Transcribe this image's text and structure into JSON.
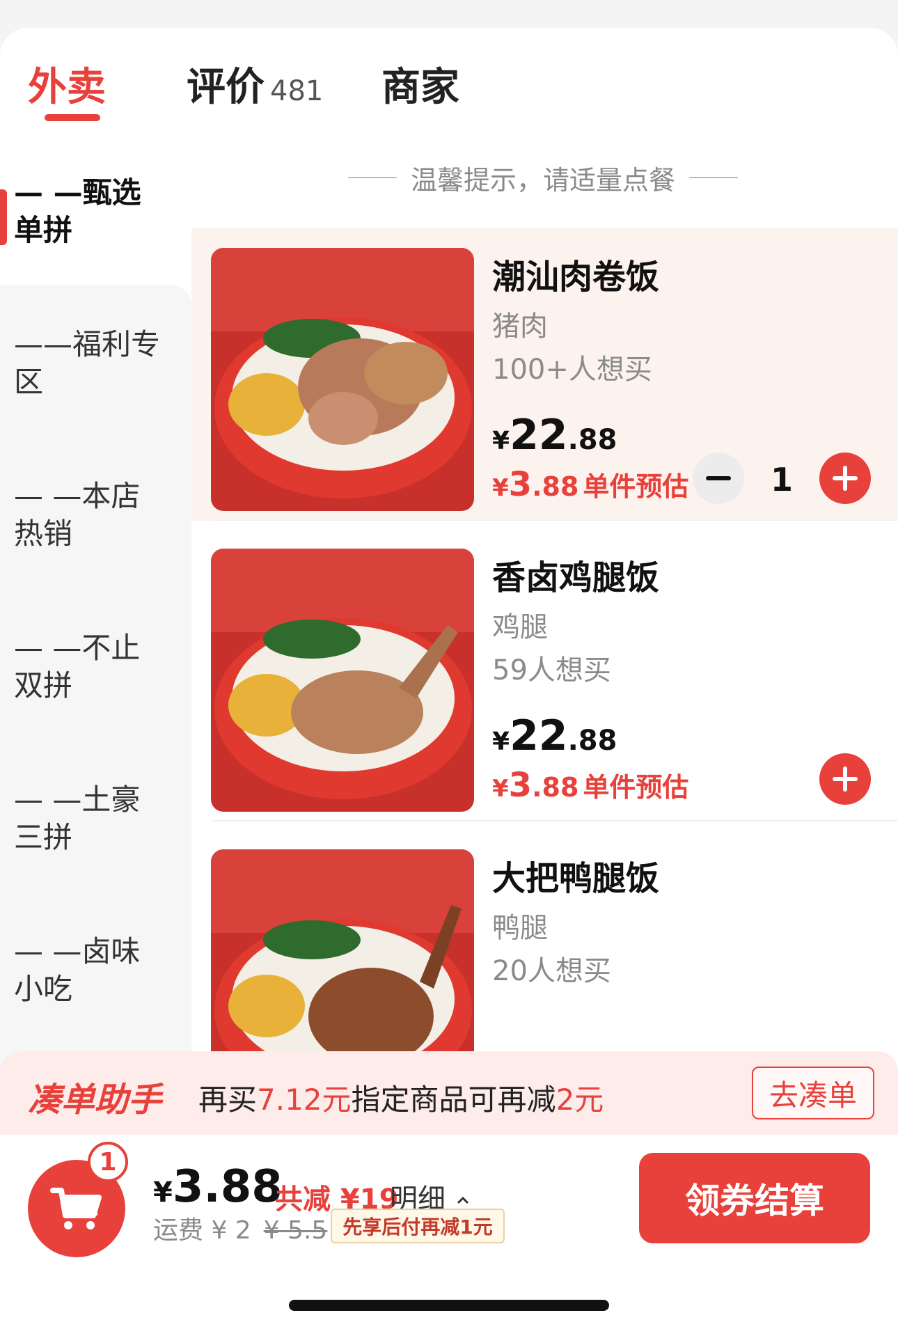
{
  "tabs": {
    "takeout": "外卖",
    "reviews": "评价",
    "reviews_count": "481",
    "merchant": "商家"
  },
  "tip": "温馨提示，请适量点餐",
  "sidebar": {
    "items": [
      {
        "line1": "—  —甄选",
        "line2": "单拼"
      },
      {
        "line1": "——福利专",
        "line2": "区"
      },
      {
        "line1": "—  —本店",
        "line2": "热销"
      },
      {
        "line1": "—  —不止",
        "line2": "双拼"
      },
      {
        "line1": "—  —土豪",
        "line2": "三拼"
      },
      {
        "line1": "—  —卤味",
        "line2": "小吃"
      }
    ]
  },
  "products": [
    {
      "name": "潮汕肉卷饭",
      "desc": "猪肉",
      "want": "100+人想买",
      "price_cur": "¥",
      "price_int": "22",
      "price_dec": ".88",
      "deal_cur": "¥",
      "deal_int": "3",
      "deal_dec": ".88",
      "deal_label": "单件预估",
      "qty": "1"
    },
    {
      "name": "香卤鸡腿饭",
      "desc": "鸡腿",
      "want": "59人想买",
      "price_cur": "¥",
      "price_int": "22",
      "price_dec": ".88",
      "deal_cur": "¥",
      "deal_int": "3",
      "deal_dec": ".88",
      "deal_label": "单件预估"
    },
    {
      "name": "大把鸭腿饭",
      "desc": "鸭腿",
      "want": "20人想买"
    }
  ],
  "helper": {
    "title": "凑单助手",
    "text_a": "再买",
    "text_amount": "7.12元",
    "text_b": "指定商品可再减",
    "text_reduce": "2元",
    "button": "去凑单"
  },
  "cart": {
    "badge": "1",
    "total_cur": "¥",
    "total": "3.88",
    "discount": "共减 ¥19",
    "detail": "明细",
    "delivery_label": "运费 ¥ 2",
    "delivery_original": "¥ 5.5",
    "later_pay": "先享后付再减1元",
    "checkout": "领券结算"
  },
  "colors": {
    "accent": "#e8403a",
    "selected_row": "#fdf3ee",
    "helper_bg": "#fdecea"
  }
}
